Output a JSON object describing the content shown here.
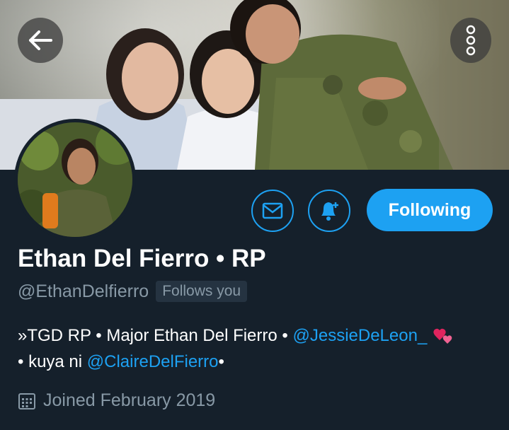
{
  "header": {
    "back_icon": "arrow-left-icon",
    "more_icon": "more-vertical-icon"
  },
  "profile": {
    "display_name": "Ethan Del Fierro • RP",
    "handle": "@EthanDelfierro",
    "follows_you": "Follows you",
    "bio": {
      "part1": "»TGD RP • Major Ethan Del Fierro • ",
      "mention1": "@JessieDeLeon_",
      "part2": " ",
      "part3": "• kuya ni ",
      "mention2": "@ClaireDelFierro",
      "part4": "•"
    },
    "joined": "Joined February 2019"
  },
  "actions": {
    "message_icon": "envelope-icon",
    "notify_icon": "bell-plus-icon",
    "following_label": "Following"
  },
  "colors": {
    "background": "#15202b",
    "accent": "#1da1f2",
    "secondary_text": "#8899a6"
  }
}
